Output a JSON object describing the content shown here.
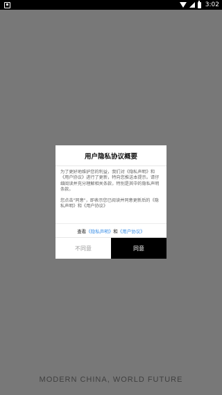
{
  "status_bar": {
    "time": "3:02",
    "icons": [
      "notification-icon",
      "wifi-icon",
      "signal-icon",
      "battery-icon"
    ]
  },
  "background": {
    "slogan": "MODERN CHINA, WORLD FUTURE"
  },
  "dialog": {
    "title": "用户隐私协议概要",
    "paragraph1": "为了更好地维护您的利益，我们对《隐私声明》和《用户协议》进行了更新，特向您推送本提示。请仔细阅读并充分理解相关条款，特别是其中的隐私声明条款。",
    "paragraph2": "您点击\"同意\"，即表示您已阅读并同意更新后的《隐私声明》和《用户协议》",
    "links_prefix": "查看",
    "privacy_link": "《隐私声明》",
    "links_and": "和",
    "agreement_link": "《用户协议》",
    "decline_label": "不同意",
    "agree_label": "同意"
  },
  "colors": {
    "overlay": "#787878",
    "link": "#3a8ee6",
    "agree_bg": "#000000"
  }
}
